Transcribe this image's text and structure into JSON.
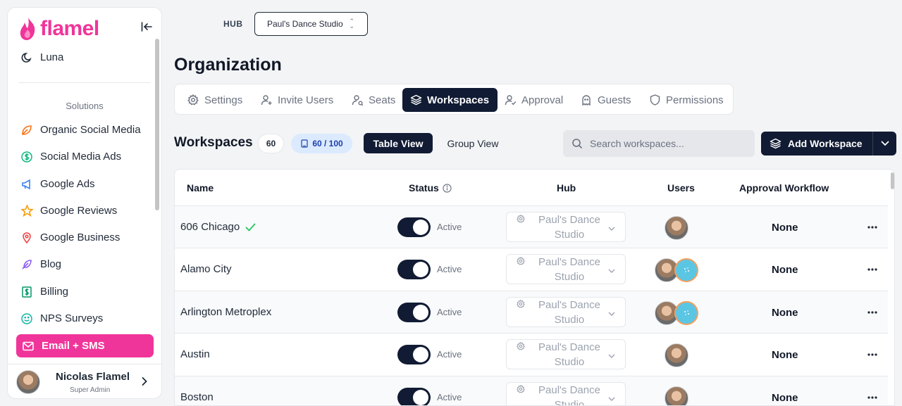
{
  "brand": {
    "name": "flamel",
    "color": "#f0359a"
  },
  "sidebar": {
    "top_item": {
      "label": "Luna",
      "icon": "moon-icon"
    },
    "section_label": "Solutions",
    "items": [
      {
        "label": "Organic Social Media",
        "icon": "leaf-icon",
        "color": "#f97316"
      },
      {
        "label": "Social Media Ads",
        "icon": "dollar-icon",
        "color": "#10b981"
      },
      {
        "label": "Google Ads",
        "icon": "megaphone-icon",
        "color": "#3b82f6"
      },
      {
        "label": "Google Reviews",
        "icon": "star-icon",
        "color": "#f59e0b"
      },
      {
        "label": "Google Business",
        "icon": "map-pin-icon",
        "color": "#ef4444"
      },
      {
        "label": "Blog",
        "icon": "feather-icon",
        "color": "#8b5cf6"
      },
      {
        "label": "Billing",
        "icon": "billing-icon",
        "color": "#059669"
      },
      {
        "label": "NPS Surveys",
        "icon": "smile-icon",
        "color": "#14b8a6"
      },
      {
        "label": "Email + SMS",
        "icon": "mail-icon",
        "active": true
      }
    ],
    "user": {
      "name": "Nicolas Flamel",
      "role": "Super Admin"
    }
  },
  "hub": {
    "label": "HUB",
    "selected": "Paul's Dance Studio"
  },
  "page": {
    "title": "Organization"
  },
  "tabs": [
    {
      "label": "Settings",
      "icon": "gear-icon"
    },
    {
      "label": "Invite Users",
      "icon": "user-plus-icon"
    },
    {
      "label": "Seats",
      "icon": "seat-user-icon"
    },
    {
      "label": "Workspaces",
      "icon": "layers-icon",
      "active": true
    },
    {
      "label": "Approval",
      "icon": "user-check-icon"
    },
    {
      "label": "Guests",
      "icon": "ghost-icon"
    },
    {
      "label": "Permissions",
      "icon": "shield-icon"
    }
  ],
  "workspaces": {
    "title": "Workspaces",
    "count": "60",
    "limit": "60 / 100",
    "table_view": "Table View",
    "group_view": "Group View",
    "search_placeholder": "Search workspaces...",
    "add_label": "Add Workspace"
  },
  "table": {
    "headers": {
      "name": "Name",
      "status": "Status",
      "hub": "Hub",
      "users": "Users",
      "approval": "Approval Workflow"
    },
    "rows": [
      {
        "name": "606 Chicago",
        "verified": true,
        "status": "Active",
        "hub_line1": "Paul's Dance",
        "hub_line2": "Studio",
        "users": [
          "person"
        ],
        "approval": "None"
      },
      {
        "name": "Alamo City",
        "status": "Active",
        "hub_line1": "Paul's Dance",
        "hub_line2": "Studio",
        "users": [
          "person",
          "bot"
        ],
        "approval": "None"
      },
      {
        "name": "Arlington Metroplex",
        "status": "Active",
        "hub_line1": "Paul's Dance",
        "hub_line2": "Studio",
        "users": [
          "person",
          "bot"
        ],
        "approval": "None"
      },
      {
        "name": "Austin",
        "status": "Active",
        "hub_line1": "Paul's Dance",
        "hub_line2": "Studio",
        "users": [
          "person"
        ],
        "approval": "None"
      },
      {
        "name": "Boston",
        "status": "Active",
        "hub_line1": "Paul's Dance",
        "hub_line2": "Studio",
        "users": [
          "person"
        ],
        "approval": "None"
      }
    ]
  }
}
